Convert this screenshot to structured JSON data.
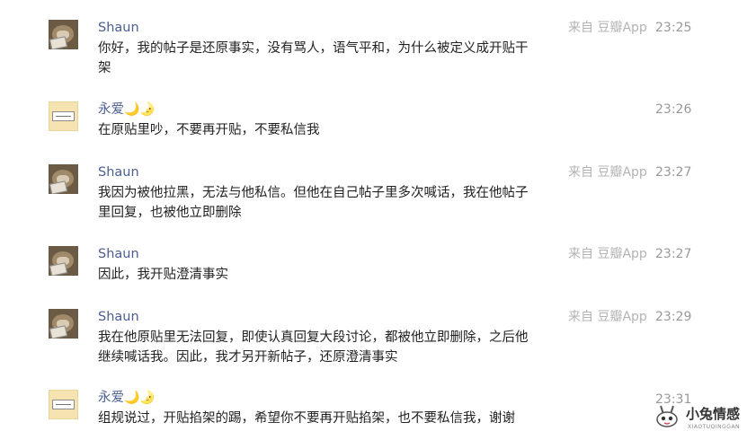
{
  "messages": [
    {
      "user": "Shaun",
      "moon": "",
      "avatar": "bear-photo-avatar",
      "source": "来自 豆瓣App",
      "time": "23:25",
      "text": "你好，我的帖子是还原事实，没有骂人，语气平和，为什么被定义成开贴干架"
    },
    {
      "user": "永爱",
      "moon": "🌙🌛",
      "avatar": "paper-card-avatar",
      "source": "",
      "time": "23:26",
      "text": "在原贴里吵，不要再开贴，不要私信我"
    },
    {
      "user": "Shaun",
      "moon": "",
      "avatar": "bear-photo-avatar",
      "source": "来自 豆瓣App",
      "time": "23:27",
      "text": "我因为被他拉黑，无法与他私信。但他在自己帖子里多次喊话，我在他帖子里回复，也被他立即删除"
    },
    {
      "user": "Shaun",
      "moon": "",
      "avatar": "bear-photo-avatar",
      "source": "来自 豆瓣App",
      "time": "23:27",
      "text": "因此，我开贴澄清事实"
    },
    {
      "user": "Shaun",
      "moon": "",
      "avatar": "bear-photo-avatar",
      "source": "来自 豆瓣App",
      "time": "23:29",
      "text": "我在他原贴里无法回复，即使认真回复大段讨论，都被他立即删除，之后他继续喊话我。因此，我才另开新帖子，还原澄清事实"
    },
    {
      "user": "永爱",
      "moon": "🌙🌛",
      "avatar": "paper-card-avatar",
      "source": "",
      "time": "23:31",
      "text": "组规说过，开贴掐架的踢，希望你不要再开贴掐架，也不要私信我，谢谢"
    }
  ],
  "watermark": {
    "title": "小兔情感",
    "subtitle": "XIAOTUQINGGAN",
    "icon": "rabbit-face-icon"
  },
  "colors": {
    "username": "#4a5d8f",
    "body_text": "#222222",
    "source": "#b3b3b3",
    "time": "#999999"
  }
}
